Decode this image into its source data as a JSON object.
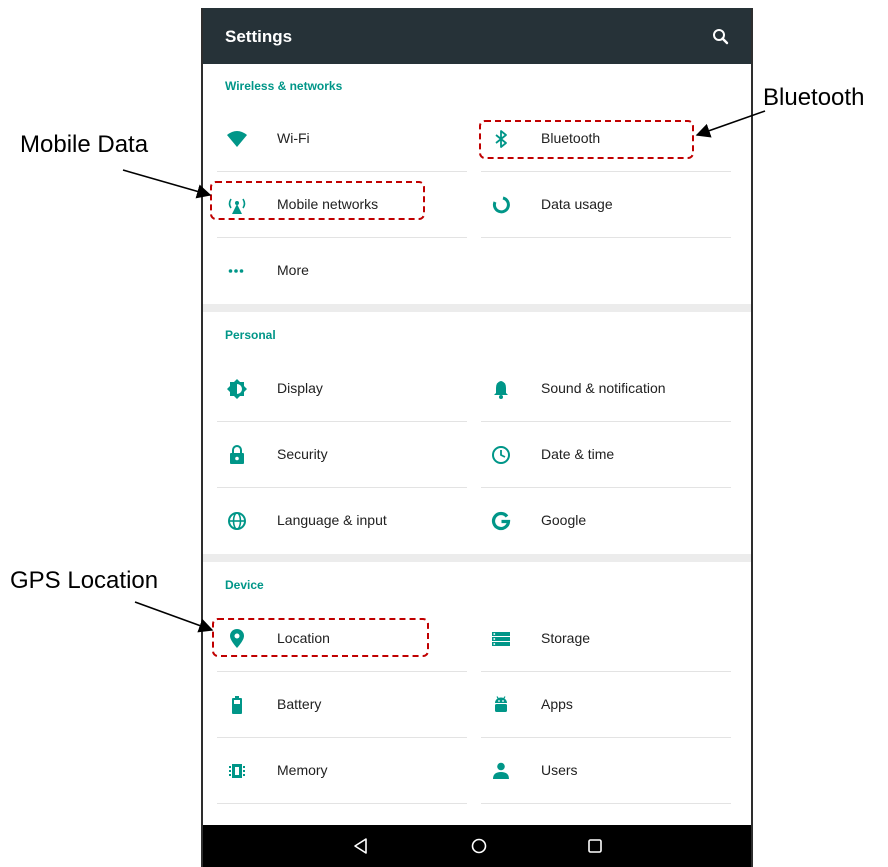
{
  "appbar": {
    "title": "Settings",
    "search_icon": "search-icon"
  },
  "sections": {
    "wireless": {
      "title": "Wireless & networks",
      "items": {
        "wifi": {
          "label": "Wi-Fi",
          "icon": "wifi-icon"
        },
        "bluetooth": {
          "label": "Bluetooth",
          "icon": "bluetooth-icon"
        },
        "mobile_networks": {
          "label": "Mobile networks",
          "icon": "signal-tower-icon"
        },
        "data_usage": {
          "label": "Data usage",
          "icon": "data-usage-icon"
        },
        "more": {
          "label": "More",
          "icon": "more-dots-icon"
        }
      }
    },
    "personal": {
      "title": "Personal",
      "items": {
        "display": {
          "label": "Display",
          "icon": "brightness-icon"
        },
        "sound": {
          "label": "Sound & notification",
          "icon": "bell-icon"
        },
        "security": {
          "label": "Security",
          "icon": "lock-icon"
        },
        "datetime": {
          "label": "Date & time",
          "icon": "clock-icon"
        },
        "language": {
          "label": "Language & input",
          "icon": "globe-icon"
        },
        "google": {
          "label": "Google",
          "icon": "google-icon"
        }
      }
    },
    "device": {
      "title": "Device",
      "items": {
        "location": {
          "label": "Location",
          "icon": "location-pin-icon"
        },
        "storage": {
          "label": "Storage",
          "icon": "storage-icon"
        },
        "battery": {
          "label": "Battery",
          "icon": "battery-icon"
        },
        "apps": {
          "label": "Apps",
          "icon": "android-icon"
        },
        "memory": {
          "label": "Memory",
          "icon": "memory-chip-icon"
        },
        "users": {
          "label": "Users",
          "icon": "user-icon"
        }
      }
    }
  },
  "navbar": {
    "back": "back-icon",
    "home": "home-icon",
    "recents": "recents-icon"
  },
  "annotations": {
    "mobile_data": "Mobile Data",
    "bluetooth": "Bluetooth",
    "gps_location": "GPS Location"
  },
  "colors": {
    "accent": "#009688",
    "appbar": "#263238",
    "callout": "#c00000"
  }
}
